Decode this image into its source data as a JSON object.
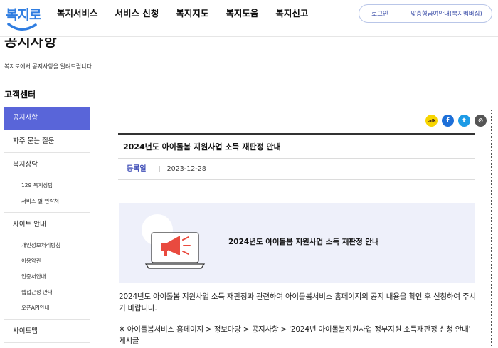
{
  "header": {
    "logo_text": "복지로",
    "nav": [
      "복지서비스",
      "서비스 신청",
      "복지지도",
      "복지도움",
      "복지신고"
    ],
    "util_login": "로그인",
    "util_custom": "맞춤형급여안내(복지멤버십)"
  },
  "page": {
    "title": "공지사항",
    "desc": "복지로에서 공지사항을 알려드립니다."
  },
  "lnb": {
    "title": "고객센터",
    "active": "공지사항",
    "faq": "자주 묻는 질문",
    "consult": "복지상담",
    "consult_sub": [
      "129 복지상담",
      "서비스 별 연락처"
    ],
    "site": "사이트 안내",
    "site_sub": [
      "개인정보처리방침",
      "이용약관",
      "인증서안내",
      "웹접근성 안내",
      "오픈API안내"
    ],
    "sitemap": "사이트맵"
  },
  "share": {
    "kakao_glyph": "talk",
    "facebook_glyph": "f",
    "twitter_glyph": "t",
    "link_glyph": "⊘"
  },
  "board": {
    "title": "2024년도 아이돌봄 지원사업 소득 재판정 안내",
    "date_label": "등록일",
    "date": "2023-12-28",
    "banner_title": "2024년도 아이돌봄 지원사업 소득 재판정 안내",
    "paragraph1": "2024년도 아이돌봄 지원사업 소득 재판정과 관련하여 아이돌봄서비스 홈페이지의 공지 내용을 확인 후 신청하여 주시기 바랍니다.",
    "paragraph2": "※ 아이돌봄서비스 홈페이지 > 정보마당 > 공지사항 > '2024년 아이돌봄지원사업 정부지원 소득재판정 신청 안내' 게시글"
  },
  "colors": {
    "accent": "#5965d9",
    "logo_blue": "#2f7de1",
    "banner_bg": "#eef0fa",
    "megaphone_red": "#e94a3f"
  }
}
